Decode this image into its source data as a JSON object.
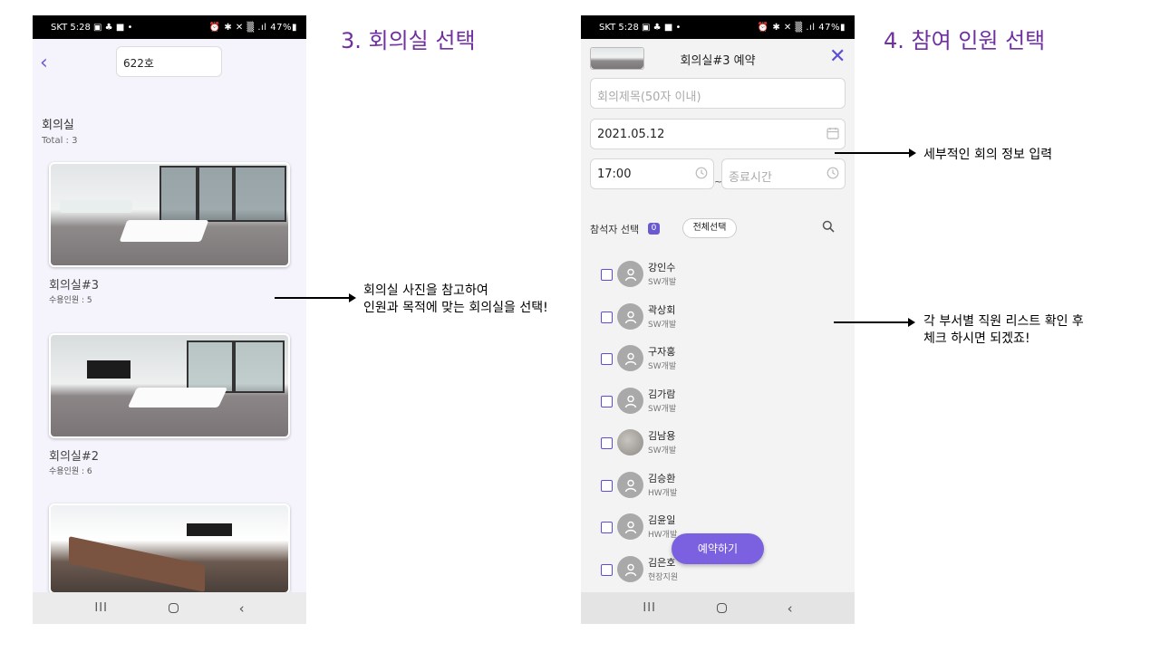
{
  "headings": {
    "step3": "3. 회의실 선택",
    "step4": "4. 참여 인원 선택"
  },
  "annotations": {
    "rooms_line1": "회의실 사진을 참고하여",
    "rooms_line2": "인원과 목적에 맞는 회의실을 선택!",
    "info": "세부적인 회의 정보 입력",
    "list_line1": "각 부서별 직원 리스트 확인 후",
    "list_line2": "체크 하시면 되겠죠!"
  },
  "status_bar": {
    "left": "SKT 5:28 ▣ ♣ ■ •",
    "right": "⏰ ✱ ✕ ▒ .ıl 47%▮"
  },
  "room_select": {
    "back": "‹",
    "floor": "622호",
    "section_title": "회의실",
    "total": "Total : 3",
    "rooms": [
      {
        "name": "회의실#3",
        "capacity": "수용인원 : 5"
      },
      {
        "name": "회의실#2",
        "capacity": "수용인원 : 6"
      }
    ]
  },
  "reservation": {
    "title": "회의실#3 예약",
    "close": "✕",
    "meeting_title_placeholder": "회의제목(50자 이내)",
    "date": "2021.05.12",
    "start_time": "17:00",
    "tilde": "~",
    "end_time_placeholder": "종료시간",
    "attendees_label": "참석자 선택",
    "attendees_count": "0",
    "select_all": "전체선택",
    "reserve_button": "예약하기",
    "people": [
      {
        "name": "강인수",
        "dept": "SW개발"
      },
      {
        "name": "곽상회",
        "dept": "SW개발"
      },
      {
        "name": "구자홍",
        "dept": "SW개발"
      },
      {
        "name": "김가람",
        "dept": "SW개발"
      },
      {
        "name": "김남용",
        "dept": "SW개발"
      },
      {
        "name": "김승환",
        "dept": "HW개발"
      },
      {
        "name": "김윤일",
        "dept": "HW개발"
      },
      {
        "name": "김은호",
        "dept": "현장지원"
      }
    ]
  },
  "nav": {
    "recents": "III",
    "back": "‹"
  },
  "icons": {
    "calendar": "calendar-icon",
    "clock": "clock-icon",
    "search": "search-icon",
    "user": "user-icon"
  },
  "colors": {
    "accent": "#7030a0",
    "brand": "#6b5bd6",
    "button": "#7b61e0"
  }
}
